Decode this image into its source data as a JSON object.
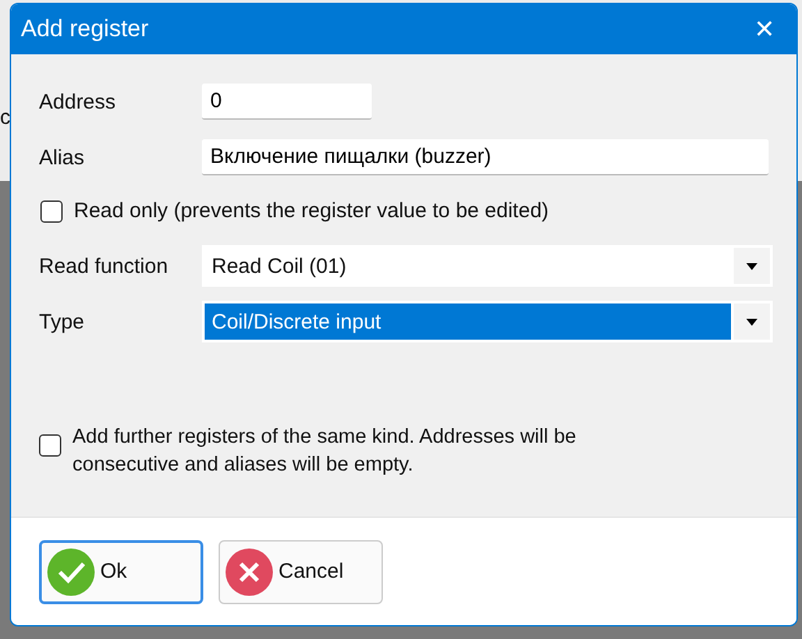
{
  "background": {
    "text": "c"
  },
  "window": {
    "title": "Add register",
    "close": "✕"
  },
  "fields": [
    {
      "label": "Address",
      "value": "0",
      "kind": "short"
    },
    {
      "label": "Alias",
      "value": "Включение пищалки (buzzer)",
      "kind": "long"
    }
  ],
  "read_only": {
    "label": "Read only (prevents the register value to be edited)",
    "checked": false
  },
  "dropdowns": [
    {
      "label": "Read function",
      "value": "Read Coil (01)",
      "selected": false
    },
    {
      "label": "Type",
      "value": "Coil/Discrete input",
      "selected": true
    }
  ],
  "further": {
    "label": "Add further registers of the same kind. Addresses will be consecutive and aliases will be empty.",
    "checked": false
  },
  "buttons": [
    {
      "label": "Ok",
      "kind": "ok",
      "selected": true
    },
    {
      "label": "Cancel",
      "kind": "cancel",
      "selected": false
    }
  ]
}
